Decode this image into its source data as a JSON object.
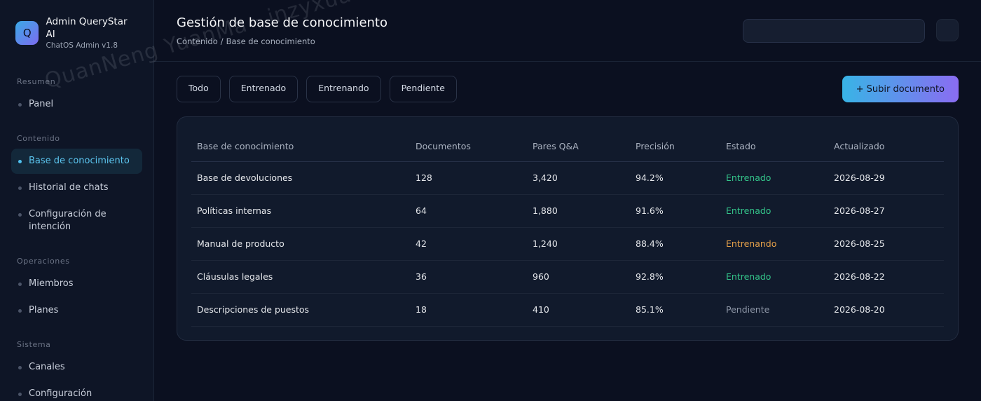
{
  "brand": {
    "logo_letter": "Q",
    "name": "Admin QueryStar AI",
    "version": "ChatOS Admin v1.8"
  },
  "sidebar": {
    "sections": [
      {
        "label": "Resumen",
        "items": [
          {
            "label": "Panel"
          }
        ]
      },
      {
        "label": "Contenido",
        "items": [
          {
            "label": "Base de conocimiento",
            "active": true
          },
          {
            "label": "Historial de chats"
          },
          {
            "label": "Configuración de intención"
          }
        ]
      },
      {
        "label": "Operaciones",
        "items": [
          {
            "label": "Miembros"
          },
          {
            "label": "Planes"
          }
        ]
      },
      {
        "label": "Sistema",
        "items": [
          {
            "label": "Canales"
          },
          {
            "label": "Configuración"
          }
        ]
      }
    ]
  },
  "header": {
    "title": "Gestión de base de conocimiento",
    "breadcrumb": {
      "parent": "Contenido",
      "separator": "/",
      "current": "Base de conocimiento"
    },
    "search_value": ""
  },
  "filters": [
    "Todo",
    "Entrenado",
    "Entrenando",
    "Pendiente"
  ],
  "upload_label": "+ Subir documento",
  "table": {
    "columns": [
      "Base de conocimiento",
      "Documentos",
      "Pares Q&A",
      "Precisión",
      "Estado",
      "Actualizado"
    ],
    "rows": [
      {
        "name": "Base de devoluciones",
        "docs": "128",
        "pairs": "3,420",
        "precision": "94.2%",
        "status": "Entrenado",
        "status_kind": "trained",
        "updated": "2026-08-29"
      },
      {
        "name": "Políticas internas",
        "docs": "64",
        "pairs": "1,880",
        "precision": "91.6%",
        "status": "Entrenado",
        "status_kind": "trained",
        "updated": "2026-08-27"
      },
      {
        "name": "Manual de producto",
        "docs": "42",
        "pairs": "1,240",
        "precision": "88.4%",
        "status": "Entrenando",
        "status_kind": "training",
        "updated": "2026-08-25"
      },
      {
        "name": "Cláusulas legales",
        "docs": "36",
        "pairs": "960",
        "precision": "92.8%",
        "status": "Entrenado",
        "status_kind": "trained",
        "updated": "2026-08-22"
      },
      {
        "name": "Descripciones de puestos",
        "docs": "18",
        "pairs": "410",
        "precision": "85.1%",
        "status": "Pendiente",
        "status_kind": "pending",
        "updated": "2026-08-20"
      }
    ]
  },
  "colors": {
    "accent": "#4fc0ee",
    "trained": "#34c48a",
    "training": "#e6a14a",
    "pending": "#8e97a7"
  },
  "watermark": "QuanNeng YuanMa · inzyxuashop.com"
}
